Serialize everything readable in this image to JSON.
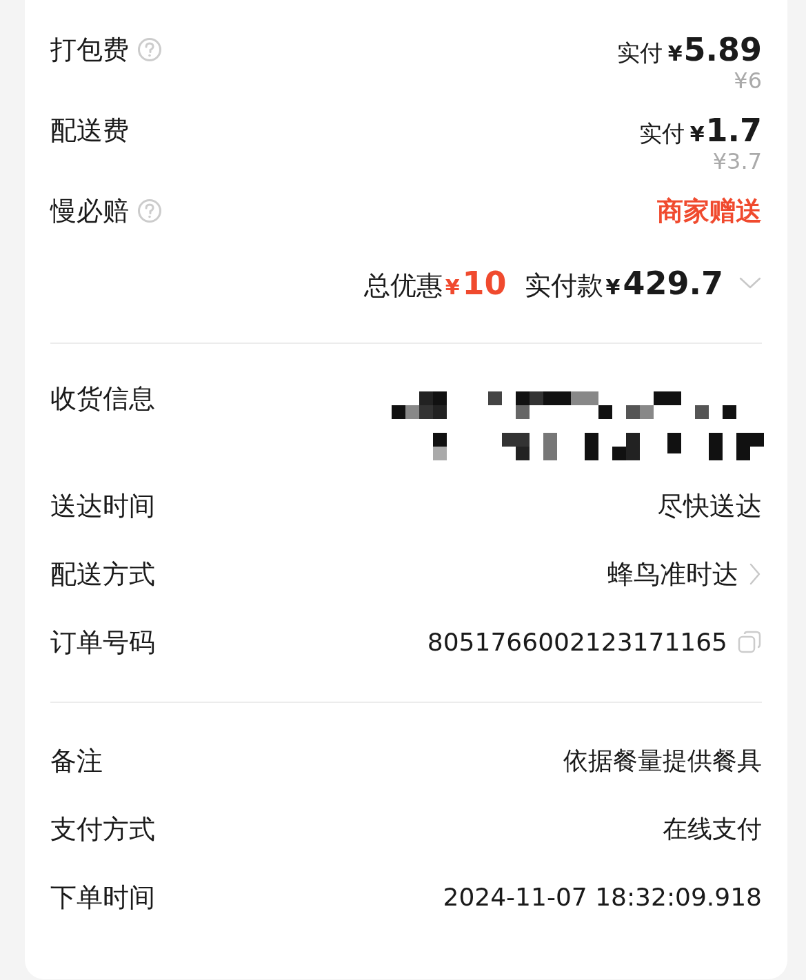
{
  "fees": [
    {
      "kind": "price",
      "label": "打包费",
      "help": true,
      "paid_label": "实付",
      "currency": "¥",
      "amount": "5.89",
      "original": "¥6"
    },
    {
      "kind": "price",
      "label": "配送费",
      "help": false,
      "paid_label": "实付",
      "currency": "¥",
      "amount": "1.7",
      "original": "¥3.7"
    },
    {
      "kind": "text",
      "label": "慢必赔",
      "help": true,
      "value": "商家赠送",
      "highlight": true
    }
  ],
  "summary": {
    "discount_label": "总优惠",
    "discount_currency": "¥",
    "discount": "10",
    "paid_label": "实付款",
    "paid_currency": "¥",
    "paid": "429.7",
    "expanded": false
  },
  "delivery": [
    {
      "kind": "redacted",
      "label": "收货信息"
    },
    {
      "kind": "text",
      "label": "送达时间",
      "value": "尽快送达"
    },
    {
      "kind": "link",
      "label": "配送方式",
      "value": "蜂鸟准时达"
    },
    {
      "kind": "copy",
      "label": "订单号码",
      "value": "8051766002123171165"
    }
  ],
  "details": [
    {
      "label": "备注",
      "value": "依据餐量提供餐具"
    },
    {
      "label": "支付方式",
      "value": "在线支付"
    },
    {
      "label": "下单时间",
      "value": "2024-11-07 18:32:09.918"
    }
  ]
}
